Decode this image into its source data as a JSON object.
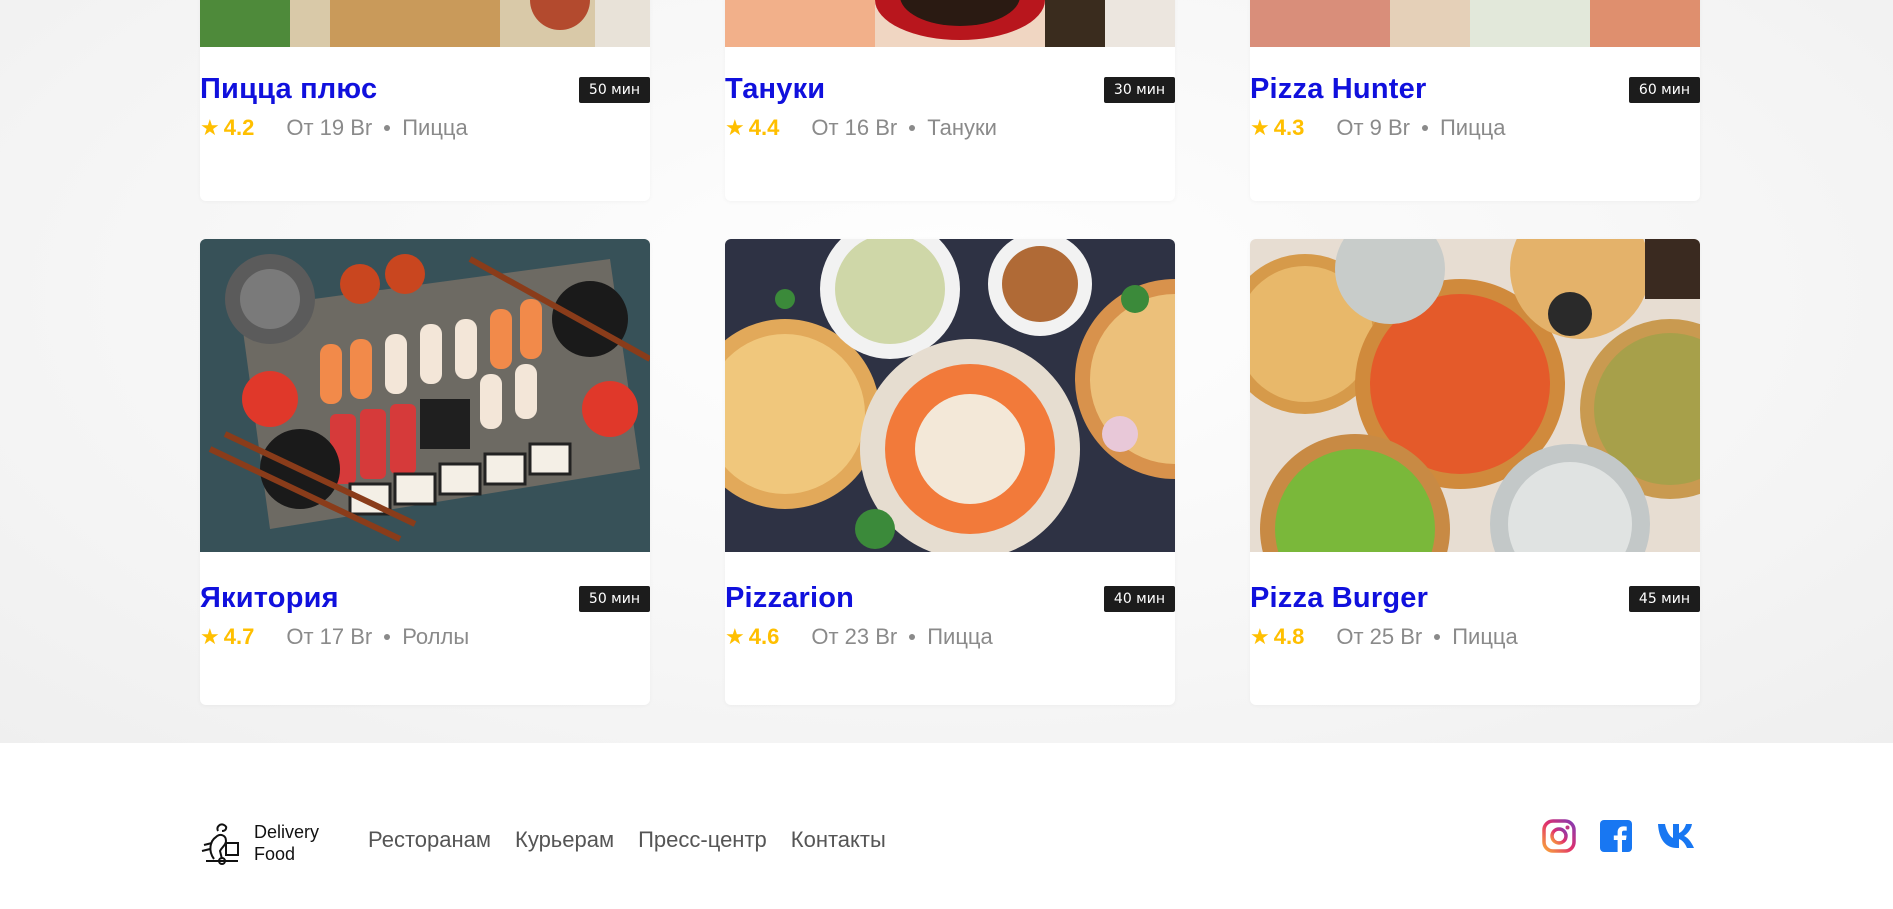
{
  "top_row": [
    {
      "title": "Пицца плюс",
      "time": "50 мин",
      "rating": "4.2",
      "price": "От 19 Br",
      "category": "Пицца"
    },
    {
      "title": "Тануки",
      "time": "30 мин",
      "rating": "4.4",
      "price": "От 16 Br",
      "category": "Тануки"
    },
    {
      "title": "Pizza Hunter",
      "time": "60 мин",
      "rating": "4.3",
      "price": "От 9 Br",
      "category": "Пицца"
    }
  ],
  "bottom_row": [
    {
      "title": "Якитория",
      "time": "50 мин",
      "rating": "4.7",
      "price": "От 17 Br",
      "category": "Роллы"
    },
    {
      "title": "Pizzarion",
      "time": "40 мин",
      "rating": "4.6",
      "price": "От 23 Br",
      "category": "Пицца"
    },
    {
      "title": "Pizza Burger",
      "time": "45 мин",
      "rating": "4.8",
      "price": "От 25 Br",
      "category": "Пицца"
    }
  ],
  "icons": {
    "star": "star-icon",
    "logo": "delivery-logo",
    "instagram": "instagram-icon",
    "facebook": "facebook-icon",
    "vk": "vk-icon"
  },
  "footer": {
    "logo_line1": "Delivery",
    "logo_line2": "Food",
    "nav": [
      "Ресторанам",
      "Курьерам",
      "Пресс-центр",
      "Контакты"
    ]
  },
  "colors": {
    "title": "#1010dd",
    "rating": "#ffbf00",
    "badge": "#1c1c1c"
  }
}
